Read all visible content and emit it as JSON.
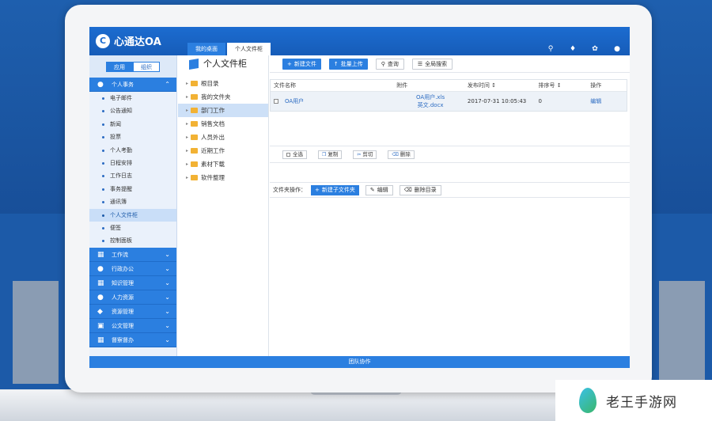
{
  "app": {
    "logo_text": "心通达OA",
    "logo_icon": "C"
  },
  "tabs": [
    "我的桌面",
    "个人文件柜"
  ],
  "header_icons": [
    "search-icon",
    "bell-icon",
    "palette-icon",
    "user-icon"
  ],
  "nav": {
    "switch": [
      "应用",
      "组织"
    ],
    "open_group": "个人事务",
    "items": [
      "电子邮件",
      "公告通知",
      "新闻",
      "投票",
      "个人考勤",
      "日程安排",
      "工作日志",
      "事务提醒",
      "通讯簿",
      "个人文件柜",
      "便签",
      "控制面板"
    ],
    "active_item": "个人文件柜",
    "groups": [
      "工作流",
      "行政办公",
      "知识管理",
      "人力资源",
      "资源管理",
      "公文管理",
      "督察督办"
    ]
  },
  "tree": {
    "title": "个人文件柜",
    "items": [
      "根目录",
      "我的文件夹",
      "部门工作",
      "销售文档",
      "人员外出",
      "近期工作",
      "素材下载",
      "软件整理"
    ],
    "active": "部门工作"
  },
  "toolbar": {
    "new_file": "新建文件",
    "batch_upload": "批量上传",
    "query": "查询",
    "global_search": "全局搜索"
  },
  "table": {
    "headers": [
      "文件名称",
      "附件",
      "发布时间",
      "排序号",
      "操作"
    ],
    "rows": [
      {
        "name": "OA用户",
        "attachments": [
          "OA用户.xls",
          "英文.docx"
        ],
        "time": "2017-07-31 10:05:43",
        "order": "0",
        "action": "编辑"
      }
    ]
  },
  "ops": {
    "select_all": "全选",
    "copy": "复制",
    "cut": "剪切",
    "delete": "删除"
  },
  "folder_ops": {
    "label": "文件夹操作：",
    "new_subfolder": "新建子文件夹",
    "edit": "编辑",
    "delete_dir": "删除目录"
  },
  "footer": "团队协作",
  "watermark": "老王手游网",
  "colors": {
    "primary": "#2b7fe0",
    "header": "#1c6cd0",
    "nav_bg": "#eaf1fb"
  }
}
